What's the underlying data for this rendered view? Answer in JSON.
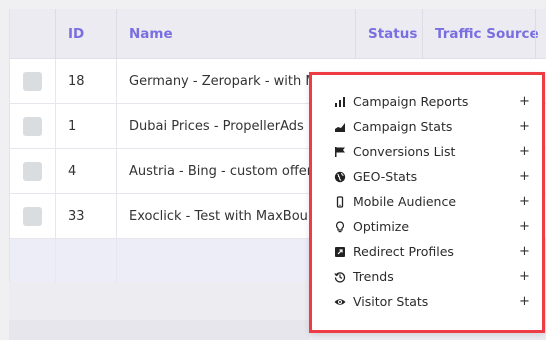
{
  "table": {
    "columns": {
      "id": "ID",
      "name": "Name",
      "status": "Status",
      "traffic_source": "Traffic Source"
    },
    "rows": [
      {
        "id": "18",
        "name": "Germany - Zeropark - with MV"
      },
      {
        "id": "1",
        "name": "Dubai Prices - PropellerAds"
      },
      {
        "id": "4",
        "name": "Austria - Bing - custom offer"
      },
      {
        "id": "33",
        "name": "Exoclick - Test with MaxBount"
      }
    ]
  },
  "menu": {
    "items": [
      {
        "label": "Campaign Reports",
        "icon": "bar-chart-icon"
      },
      {
        "label": "Campaign Stats",
        "icon": "area-chart-icon"
      },
      {
        "label": "Conversions List",
        "icon": "flag-icon"
      },
      {
        "label": "GEO-Stats",
        "icon": "globe-icon"
      },
      {
        "label": "Mobile Audience",
        "icon": "mobile-icon"
      },
      {
        "label": "Optimize",
        "icon": "lightbulb-icon"
      },
      {
        "label": "Redirect Profiles",
        "icon": "redirect-icon"
      },
      {
        "label": "Trends",
        "icon": "history-icon"
      },
      {
        "label": "Visitor Stats",
        "icon": "eye-icon"
      }
    ],
    "expand_symbol": "+"
  },
  "colors": {
    "header_text": "#7a6fe0",
    "menu_border": "#ef3b44",
    "header_bg": "#ebebf1",
    "summary_row_bg": "#ededf7"
  }
}
